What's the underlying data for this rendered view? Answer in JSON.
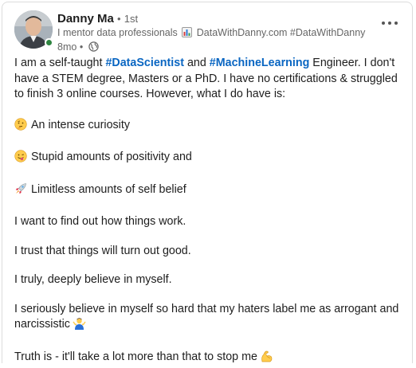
{
  "post": {
    "author": {
      "name": "Danny Ma",
      "separator": "•",
      "degree": "1st",
      "headline_pre": "I mentor data professionals",
      "headline_post": "DataWithDanny.com #DataWithDanny",
      "time": "8mo",
      "time_separator": "•"
    },
    "body": {
      "intro_1": "I am a self-taught ",
      "hashtag_1": "#DataScientist",
      "intro_2": " and ",
      "hashtag_2": "#MachineLearning",
      "intro_3": " Engineer. I don't have a STEM degree, Masters or a PhD. I have no certifications & struggled to finish 3 online courses. However, what I do have is:",
      "item_1": "An intense curiosity",
      "item_2": "Stupid amounts of positivity and",
      "item_3": "Limitless amounts of self belief",
      "para_1": "I want to find out how things work.",
      "para_2": "I trust that things will turn out good.",
      "para_3": "I truly, deeply believe in myself.",
      "para_4": "I seriously believe in myself so hard that my haters label me as arrogant and narcissistic",
      "para_5": "Truth is - it'll take a lot more than that to stop me"
    },
    "icons": {
      "headline": "bar-chart-icon",
      "visibility": "globe-icon",
      "item_1": "thinking-face-emoji",
      "item_2": "winking-tongue-face-emoji",
      "item_3": "rocket-emoji",
      "para_4": "person-shrugging-emoji",
      "para_5": "flexed-biceps-emoji"
    },
    "colors": {
      "hashtag": "#0a66c2",
      "presence": "#2e8540"
    }
  }
}
